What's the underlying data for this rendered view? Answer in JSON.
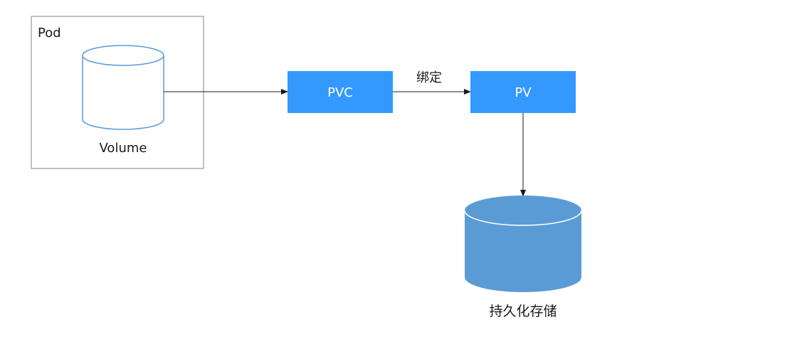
{
  "pod": {
    "label": "Pod"
  },
  "volume": {
    "label": "Volume"
  },
  "pvc": {
    "label": "PVC"
  },
  "pv": {
    "label": "PV"
  },
  "binding": {
    "label": "绑定"
  },
  "storage": {
    "label": "持久化存储"
  },
  "colors": {
    "box_fill": "#3399ff",
    "storage_fill": "#5b9bd5",
    "volume_stroke": "#5b9bd5",
    "pod_border": "#808080",
    "arrow": "#1a1a1a"
  }
}
